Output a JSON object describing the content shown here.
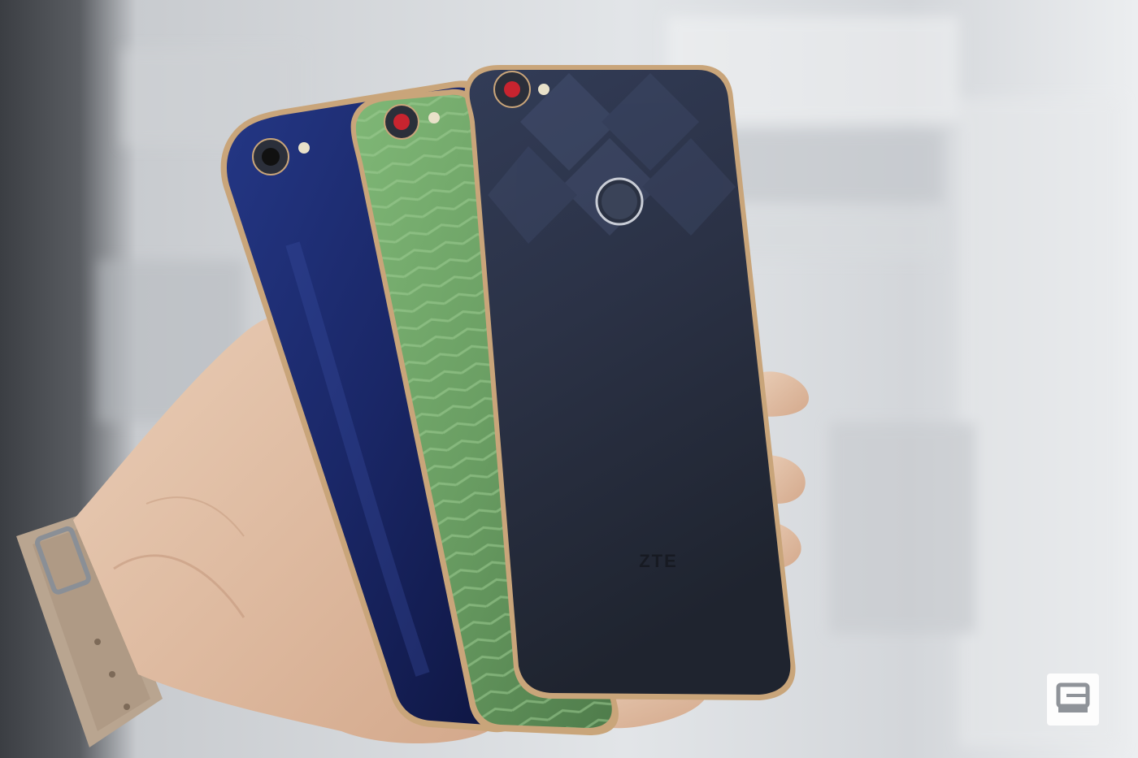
{
  "photo": {
    "phone_brand_text": "ZTE",
    "colors": {
      "background_light": "#dfe2e6",
      "background_dark": "#4a4d52",
      "phone_navy": "#1c2a6b",
      "phone_green": "#6fa36a",
      "phone_slate": "#2a3142",
      "skin": "#e3c2a8",
      "strap": "#b9a590",
      "camera_red": "#c8242f",
      "trim_gold": "#c9a57a"
    },
    "icons": [
      "engadget-logo-icon",
      "camera-lens-icon",
      "fingerprint-sensor-icon",
      "watch-strap"
    ]
  }
}
